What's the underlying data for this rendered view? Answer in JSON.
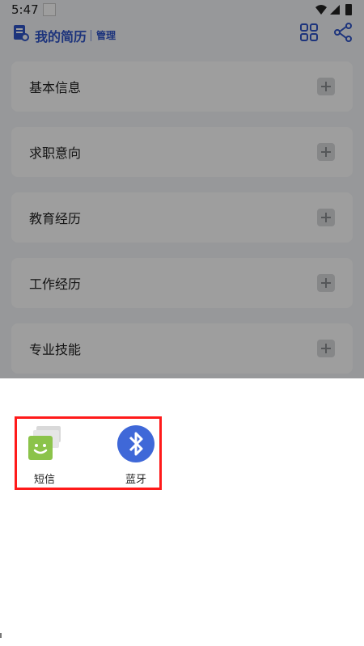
{
  "status_bar": {
    "time": "5:47"
  },
  "header": {
    "title": "我的简历",
    "manage_label": "管理"
  },
  "cards": [
    {
      "label": "基本信息"
    },
    {
      "label": "求职意向"
    },
    {
      "label": "教育经历"
    },
    {
      "label": "工作经历"
    },
    {
      "label": "专业技能"
    }
  ],
  "share_sheet": {
    "items": [
      {
        "label": "短信",
        "icon": "sms-app-icon",
        "color": "#8bc34a"
      },
      {
        "label": "蓝牙",
        "icon": "bluetooth-icon",
        "color": "#3f68d8"
      }
    ],
    "highlight_color": "#ff1a1a"
  },
  "colors": {
    "accent": "#2f54c9"
  }
}
